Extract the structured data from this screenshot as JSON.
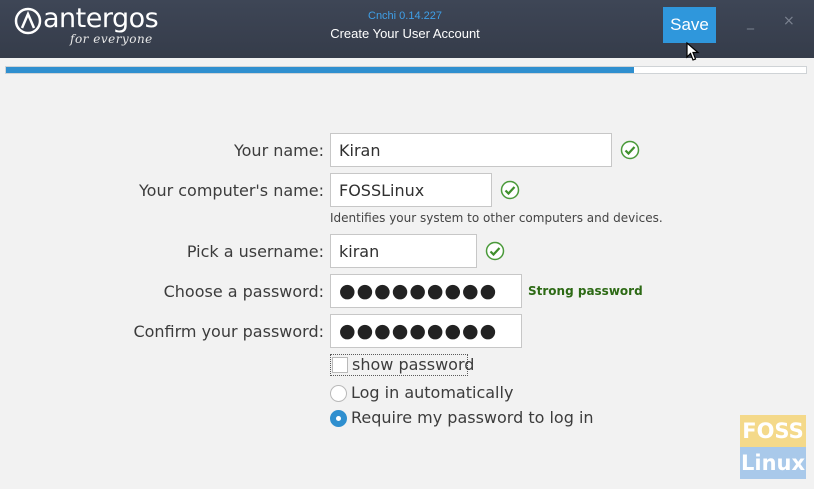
{
  "header": {
    "logo_text": "antergos",
    "logo_tagline": "for everyone",
    "app_version": "Cnchi  0.14.227",
    "title": "Create Your User Account",
    "save_label": "Save",
    "minimize_glyph": "_",
    "close_glyph": "×",
    "background_color": "#3a4150",
    "accent_color": "#2f97dc"
  },
  "progress": {
    "fraction": 0.785
  },
  "form": {
    "your_name": {
      "label": "Your name:",
      "value": "Kiran",
      "valid": true
    },
    "computer_name": {
      "label": "Your computer's name:",
      "value": "FOSSLinux",
      "valid": true,
      "hint": "Identifies your system to other computers and devices."
    },
    "username": {
      "label": "Pick a username:",
      "value": "kiran",
      "valid": true
    },
    "password": {
      "label": "Choose a password:",
      "value": "●●●●●●●●●",
      "strength": "Strong password",
      "strength_color": "#2d6a15"
    },
    "confirm_password": {
      "label": "Confirm your password:",
      "value": "●●●●●●●●●"
    },
    "show_password": {
      "label": "show password",
      "checked": false
    },
    "login_options": [
      {
        "label": "Log in automatically",
        "selected": false
      },
      {
        "label": "Require my password to log in",
        "selected": true
      }
    ]
  },
  "watermark": {
    "top": "FOSS",
    "bottom": "Linux"
  },
  "icons": {
    "logo": "antergos-logo-icon",
    "valid": "check-circle-icon",
    "cursor": "mouse-cursor-icon"
  }
}
